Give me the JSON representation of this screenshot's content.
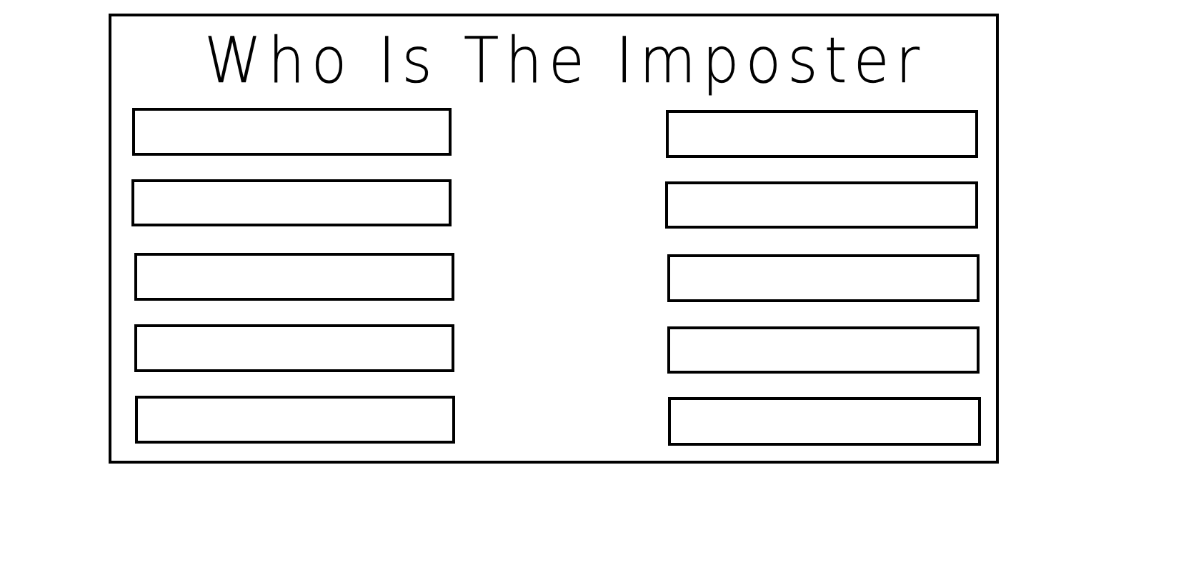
{
  "title": "Who Is The Imposter",
  "slots": {
    "left": [
      {
        "label": ""
      },
      {
        "label": ""
      },
      {
        "label": ""
      },
      {
        "label": ""
      },
      {
        "label": ""
      }
    ],
    "right": [
      {
        "label": ""
      },
      {
        "label": ""
      },
      {
        "label": ""
      },
      {
        "label": ""
      },
      {
        "label": ""
      }
    ]
  }
}
